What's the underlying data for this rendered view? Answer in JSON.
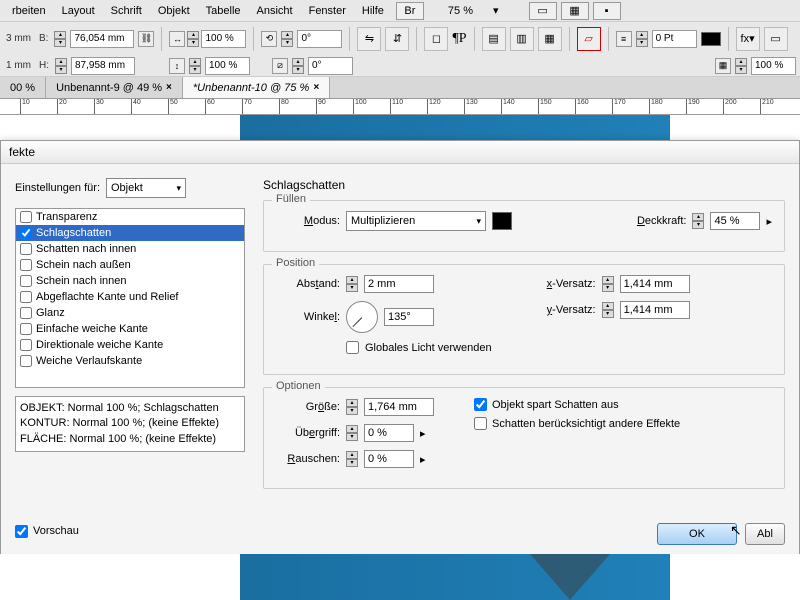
{
  "menu": {
    "items": [
      "rbeiten",
      "Layout",
      "Schrift",
      "Objekt",
      "Tabelle",
      "Ansicht",
      "Fenster",
      "Hilfe"
    ],
    "br": "Br",
    "zoom": "75 %"
  },
  "toolbar": {
    "mm_unit": "3 mm",
    "B": "76,054 mm",
    "H": "87,958 mm",
    "scaleX": "100 %",
    "scaleY": "100 %",
    "rot": "0°",
    "shear": "0°",
    "stroke_pt": "0 Pt",
    "stroke_pct": "100 %"
  },
  "tabs": [
    {
      "label": "00 %",
      "active": false
    },
    {
      "label": "Unbenannt-9 @ 49 %",
      "active": false
    },
    {
      "label": "*Unbenannt-10 @ 75 %",
      "active": true
    }
  ],
  "ruler": {
    "ticks": [
      "10",
      "20",
      "30",
      "40",
      "50",
      "60",
      "70",
      "80",
      "90",
      "100",
      "110",
      "120",
      "130",
      "140",
      "150",
      "160",
      "170",
      "180",
      "190",
      "200",
      "210"
    ]
  },
  "dialog": {
    "title": "fekte",
    "settings_for": "Einstellungen für:",
    "settings_target": "Objekt",
    "effects": [
      {
        "label": "Transparenz",
        "checked": false
      },
      {
        "label": "Schlagschatten",
        "checked": true,
        "selected": true
      },
      {
        "label": "Schatten nach innen",
        "checked": false
      },
      {
        "label": "Schein nach außen",
        "checked": false
      },
      {
        "label": "Schein nach innen",
        "checked": false
      },
      {
        "label": "Abgeflachte Kante und Relief",
        "checked": false
      },
      {
        "label": "Glanz",
        "checked": false
      },
      {
        "label": "Einfache weiche Kante",
        "checked": false
      },
      {
        "label": "Direktionale weiche Kante",
        "checked": false
      },
      {
        "label": "Weiche Verlaufskante",
        "checked": false
      }
    ],
    "summary_lines": [
      "OBJEKT: Normal 100 %; Schlagschatten",
      "KONTUR: Normal 100 %; (keine Effekte)",
      "FLÄCHE: Normal 100 %; (keine Effekte)"
    ],
    "panel_title": "Schlagschatten",
    "fill": {
      "group": "Füllen",
      "mode_label": "Modus:",
      "mode_value": "Multiplizieren",
      "opacity_label": "Deckkraft:",
      "opacity_value": "45 %"
    },
    "position": {
      "group": "Position",
      "abstand_label": "Abstand:",
      "abstand_value": "2 mm",
      "winkel_label": "Winkel:",
      "winkel_value": "135°",
      "global_light": "Globales Licht verwenden",
      "x_label": "x-Versatz:",
      "x_value": "1,414 mm",
      "y_label": "y-Versatz:",
      "y_value": "1,414 mm"
    },
    "options": {
      "group": "Optionen",
      "groesse_label": "Größe:",
      "groesse_value": "1,764 mm",
      "uebergriff_label": "Übergriff:",
      "uebergriff_value": "0 %",
      "rauschen_label": "Rauschen:",
      "rauschen_value": "0 %",
      "spart": "Objekt spart Schatten aus",
      "beruecksichtigt": "Schatten berücksichtigt andere Effekte"
    },
    "preview": "Vorschau",
    "ok": "OK",
    "abbrechen": "Abl"
  }
}
